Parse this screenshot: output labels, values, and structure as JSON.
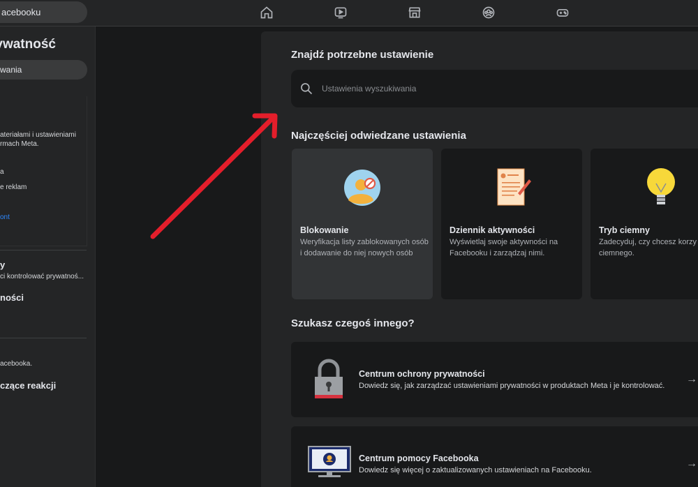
{
  "topbar": {
    "search_value": "acebooku",
    "icons": [
      "home-icon",
      "watch-icon",
      "marketplace-icon",
      "groups-icon",
      "gaming-icon"
    ]
  },
  "sidebar": {
    "title": "rywatność",
    "search_value": "wania",
    "card_lines": [
      "ateriałami i ustawieniami",
      "rmach Meta.",
      "a",
      "e reklam"
    ],
    "card_link": "ont",
    "section1_title": "y",
    "section1_sub": "ci kontrolować prywatnoś...",
    "section2_title": "ności",
    "section3_sub": "acebooka.",
    "section3_title": "czące reakcji"
  },
  "main": {
    "find_heading": "Znajdź potrzebne ustawienie",
    "search_placeholder": "Ustawienia wyszukiwania",
    "frequent_heading": "Najczęściej odwiedzane ustawienia",
    "cards": [
      {
        "title": "Blokowanie",
        "desc": "Weryfikacja listy zablokowanych osób i dodawanie do niej nowych osób",
        "icon": "blocking-icon"
      },
      {
        "title": "Dziennik aktywności",
        "desc": "Wyświetlaj swoje aktywności na Facebooku i zarządzaj nimi.",
        "icon": "activity-log-icon"
      },
      {
        "title": "Tryb ciemny",
        "desc": "Zadecyduj, czy chcesz korzy trybu ciemnego.",
        "icon": "lightbulb-icon"
      }
    ],
    "other_heading": "Szukasz czegoś innego?",
    "rows": [
      {
        "title": "Centrum ochrony prywatności",
        "desc": "Dowiedz się, jak zarządzać ustawieniami prywatności w produktach Meta i je kontrolować.",
        "arrow": "→",
        "icon": "padlock-icon"
      },
      {
        "title": "Centrum pomocy Facebooka",
        "desc": "Dowiedz się więcej o zaktualizowanych ustawieniach na Facebooku.",
        "arrow": "→",
        "icon": "monitor-icon"
      }
    ]
  },
  "colors": {
    "page_bg": "#18191a",
    "surface": "#242526",
    "accent_arrow": "#e41e2b",
    "link_blue": "#2d88ff"
  }
}
